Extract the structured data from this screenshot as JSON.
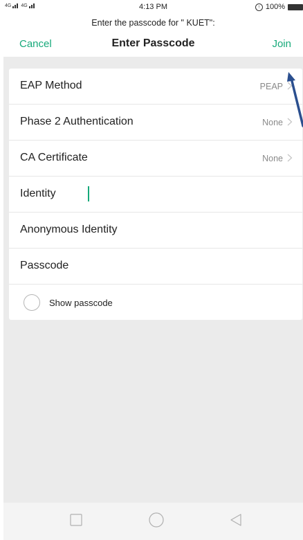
{
  "status_bar": {
    "signal_labels": [
      "4G",
      "4G"
    ],
    "time": "4:13 PM",
    "battery": "100%"
  },
  "nav": {
    "prompt": "Enter the passcode for \" KUET\":",
    "cancel_label": "Cancel",
    "title": "Enter Passcode",
    "join_label": "Join"
  },
  "form": {
    "eap_method": {
      "label": "EAP Method",
      "value": "PEAP"
    },
    "phase2": {
      "label": "Phase 2 Authentication",
      "value": "None"
    },
    "ca_certificate": {
      "label": "CA Certificate",
      "value": "None"
    },
    "identity": {
      "label": "Identity"
    },
    "anonymous_identity": {
      "label": "Anonymous Identity"
    },
    "passcode": {
      "label": "Passcode"
    },
    "show_passcode": {
      "label": "Show passcode",
      "checked": false
    }
  },
  "colors": {
    "accent": "#16a97a",
    "annotation": "#2b4f8f",
    "background": "#ebebeb"
  },
  "bottom_nav": {
    "icons": [
      "square-icon",
      "circle-icon",
      "triangle-back-icon"
    ]
  }
}
